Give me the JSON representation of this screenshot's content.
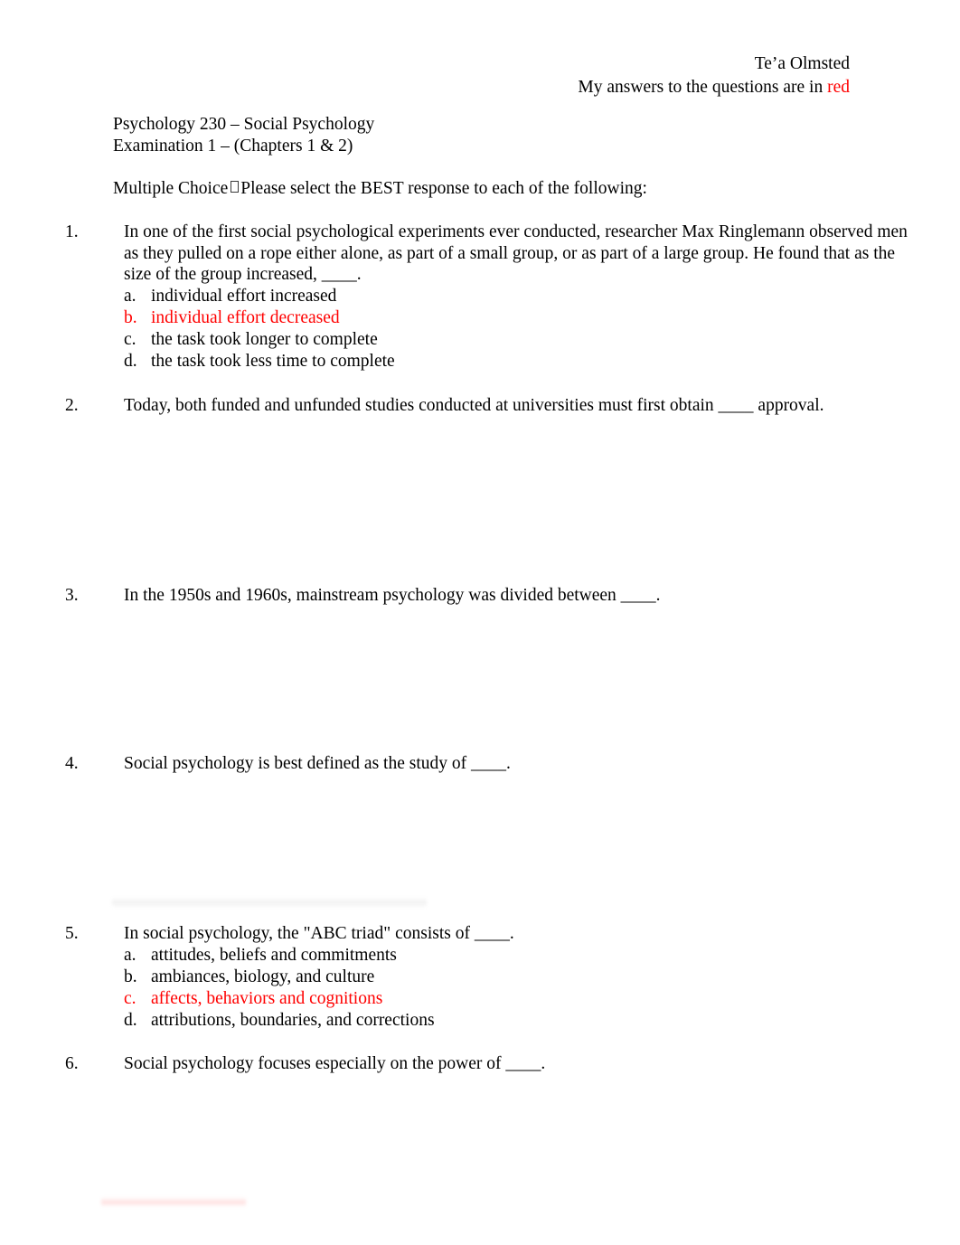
{
  "header": {
    "student_name": "Te’a Olmsted",
    "answer_key_note": "My answers to the questions are in",
    "answer_key_color_word": "red",
    "answer_color_hex": "#FF0000"
  },
  "title_block": {
    "course_line": "Psychology 230 – Social Psychology",
    "exam_line": "Examination 1 – (Chapters 1 & 2)"
  },
  "instructions": {
    "prefix": "Multiple Choice",
    "missing_glyph": "\u0000",
    "suffix": "Please select the BEST response to each of the following:"
  },
  "questions": [
    {
      "number": "1.",
      "text": "In one of the first social psychological experiments ever conducted, researcher Max Ringlemann observed men as they pulled on a rope either alone, as part of a small group, or as part of a large group. He found that as the size of the group increased, ____.",
      "options": [
        {
          "label": "a.",
          "text": "individual effort increased",
          "selected": false
        },
        {
          "label": "b.",
          "text": "individual effort decreased",
          "selected": true
        },
        {
          "label": "c.",
          "text": "the task took longer to complete",
          "selected": false
        },
        {
          "label": "d.",
          "text": "the task took less time to complete",
          "selected": false
        }
      ]
    },
    {
      "number": "2.",
      "text": "Today, both funded and unfunded studies conducted at universities must first obtain ____ approval.",
      "options": []
    },
    {
      "number": "3.",
      "text": "In the 1950s and 1960s, mainstream psychology was divided between ____.",
      "options": []
    },
    {
      "number": "4.",
      "text": "Social psychology is best defined as the study of ____.",
      "options": []
    },
    {
      "number": "5.",
      "text": "In social psychology, the \"ABC triad\" consists of ____.",
      "options": [
        {
          "label": "a.",
          "text": "attitudes, beliefs and commitments",
          "selected": false
        },
        {
          "label": "b.",
          "text": "ambiances, biology, and culture",
          "selected": false
        },
        {
          "label": "c.",
          "text": "affects, behaviors and cognitions",
          "selected": true
        },
        {
          "label": "d.",
          "text": "attributions, boundaries, and corrections",
          "selected": false
        }
      ]
    },
    {
      "number": "6.",
      "text": "Social psychology focuses especially on the power of ____.",
      "options": []
    }
  ]
}
